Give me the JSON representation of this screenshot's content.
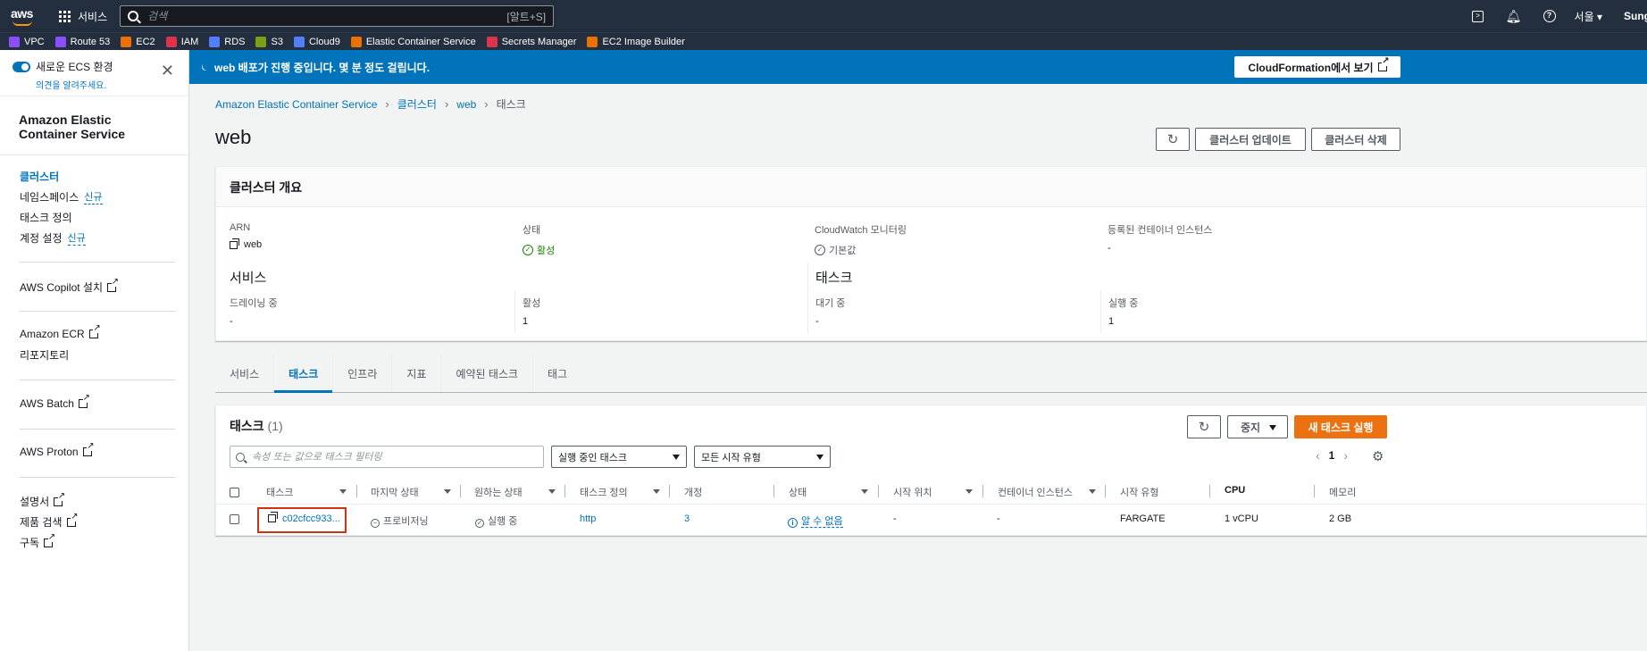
{
  "topnav": {
    "logo_text": "aws",
    "services_label": "서비스",
    "search_placeholder": "검색",
    "search_hint": "[알트+S]",
    "region": "서울 ▾",
    "user": "Sung"
  },
  "favorites": [
    {
      "label": "VPC",
      "color": "#8c4fff"
    },
    {
      "label": "Route 53",
      "color": "#8c4fff"
    },
    {
      "label": "EC2",
      "color": "#ed7100"
    },
    {
      "label": "IAM",
      "color": "#dd344c"
    },
    {
      "label": "RDS",
      "color": "#527fff"
    },
    {
      "label": "S3",
      "color": "#7aa116"
    },
    {
      "label": "Cloud9",
      "color": "#527fff"
    },
    {
      "label": "Elastic Container Service",
      "color": "#ed7100"
    },
    {
      "label": "Secrets Manager",
      "color": "#dd344c"
    },
    {
      "label": "EC2 Image Builder",
      "color": "#ed7100"
    }
  ],
  "sidebar": {
    "toggle_title": "새로운 ECS 환경",
    "toggle_sub": "의견을 알려주세요.",
    "title": "Amazon Elastic Container Service",
    "nav": {
      "clusters": "클러스터",
      "namespaces": "네임스페이스",
      "task_definitions": "태스크 정의",
      "account_settings": "계정 설정",
      "new_badge": "신규"
    },
    "copilot": "AWS Copilot 설치",
    "ecr": "Amazon ECR",
    "repositories": "리포지토리",
    "batch": "AWS Batch",
    "proton": "AWS Proton",
    "docs": "설명서",
    "product_search": "제품 검색",
    "subscribe": "구독"
  },
  "flash": {
    "message": "web 배포가 진행 중입니다. 몇 분 정도 걸립니다.",
    "button": "CloudFormation에서 보기"
  },
  "breadcrumb": {
    "items": [
      "Amazon Elastic Container Service",
      "클러스터",
      "web"
    ],
    "current": "태스크"
  },
  "page": {
    "title": "web",
    "update_button": "클러스터 업데이트",
    "delete_button": "클러스터 삭제"
  },
  "overview": {
    "title": "클러스터 개요",
    "arn_label": "ARN",
    "arn_value": "web",
    "status_label": "상태",
    "status_value": "활성",
    "cloudwatch_label": "CloudWatch 모니터링",
    "cloudwatch_value": "기본값",
    "instances_label": "등록된 컨테이너 인스턴스",
    "instances_value": "-",
    "services_title": "서비스",
    "draining_label": "드레이닝 중",
    "draining_value": "-",
    "active_label": "활성",
    "active_value": "1",
    "tasks_title": "태스크",
    "pending_label": "대기 중",
    "pending_value": "-",
    "running_label": "실행 중",
    "running_value": "1"
  },
  "tabs": [
    "서비스",
    "태스크",
    "인프라",
    "지표",
    "예약된 태스크",
    "태그"
  ],
  "tasks": {
    "title": "태스크",
    "count": "(1)",
    "stop_button": "중지",
    "run_button": "새 태스크 실행",
    "filter_placeholder": "속성 또는 값으로 태스크 필터링",
    "status_filter": "실행 중인 태스크",
    "launch_filter": "모든 시작 유형",
    "page": "1",
    "columns": [
      "태스크",
      "마지막 상태",
      "원하는 상태",
      "태스크 정의",
      "개정",
      "상태",
      "시작 위치",
      "컨테이너 인스턴스",
      "시작 유형",
      "CPU",
      "메모리"
    ],
    "rows": [
      {
        "task": "c02cfcc933...",
        "last_status": "프로비저닝",
        "desired_status": "실행 중",
        "task_definition": "http",
        "revision": "3",
        "health": "알 수 없음",
        "started_by": "-",
        "container_instance": "-",
        "launch_type": "FARGATE",
        "cpu": "1 vCPU",
        "memory": "2 GB"
      }
    ]
  }
}
